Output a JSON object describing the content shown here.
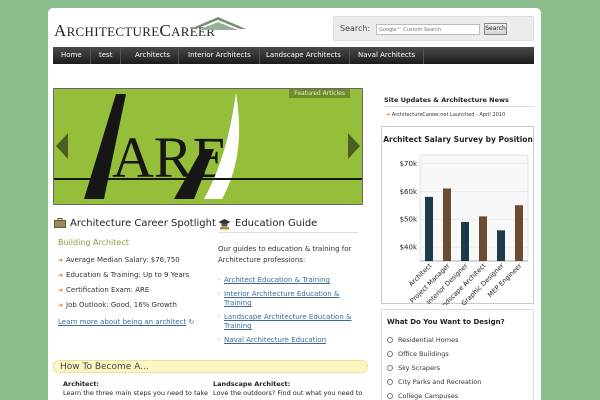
{
  "logo": {
    "big1": "A",
    "small1": "RCHITECTURE",
    "big2": "C",
    "small2": "AREER"
  },
  "search": {
    "label": "Search:",
    "placeholder": "Google™ Custom Search",
    "button": "Search"
  },
  "nav": [
    "Home",
    "test",
    "Architects",
    "Interior Architects",
    "Landscape Architects",
    "Naval Architects"
  ],
  "hero": {
    "featured_label": "Featured Articles",
    "art_text": "ARE"
  },
  "spotlight": {
    "title": "Architecture Career Spotlight",
    "subtitle": "Building Architect",
    "items": [
      "Average Median Salary: $76,750",
      "Education & Training: Up to 9 Years",
      "Certification Exam: ARE",
      "Job Outlook: Good, 16% Growth"
    ],
    "more_link": "Learn more about being an architect"
  },
  "education": {
    "title": "Education Guide",
    "intro": "Our guides to education & training for Architecture professions:",
    "links": [
      "Architect Education & Training",
      "Interior Architecture Education & Training",
      "Landscape Architecture Education & Training",
      "Naval Architecture Education"
    ]
  },
  "howto": {
    "title": "How To Become A...",
    "col1_title": "Architect:",
    "col1_text": "Learn the three main steps you need to take",
    "col2_title": "Landscape Architect:",
    "col2_text": "Love the outdoors? Find out what you need to"
  },
  "updates": {
    "title": "Site Updates & Architecture News",
    "items": [
      "ArchitectureCareer.net Launched - April 2010"
    ]
  },
  "chart_data": {
    "type": "bar",
    "title": "Architect Salary Survey by Position",
    "categories": [
      "Architect",
      "Project Manager",
      "Interior Designer",
      "Landscape Architect",
      "Graphic Designer",
      "MEP Engineer"
    ],
    "values": [
      58,
      61,
      49,
      51,
      46,
      55
    ],
    "yticks": [
      "$70k",
      "$60k",
      "$50k",
      "$40k"
    ],
    "ytick_values": [
      70,
      60,
      50,
      40
    ],
    "ylim": [
      35,
      73
    ],
    "colors": [
      "#1d3a4a",
      "#6b4c32",
      "#1d3a4a",
      "#6b4c32",
      "#1d3a4a",
      "#6b4c32"
    ]
  },
  "design": {
    "title": "What Do You Want to Design?",
    "options": [
      "Residential Homes",
      "Office Buildings",
      "Sky Scrapers",
      "City Parks and Recreation",
      "College Campuses"
    ]
  },
  "colors": {
    "background": "#8cbd8c",
    "hero_green": "#8cb833",
    "accent_orange": "#d46a12",
    "link_blue": "#3a6a9a"
  }
}
